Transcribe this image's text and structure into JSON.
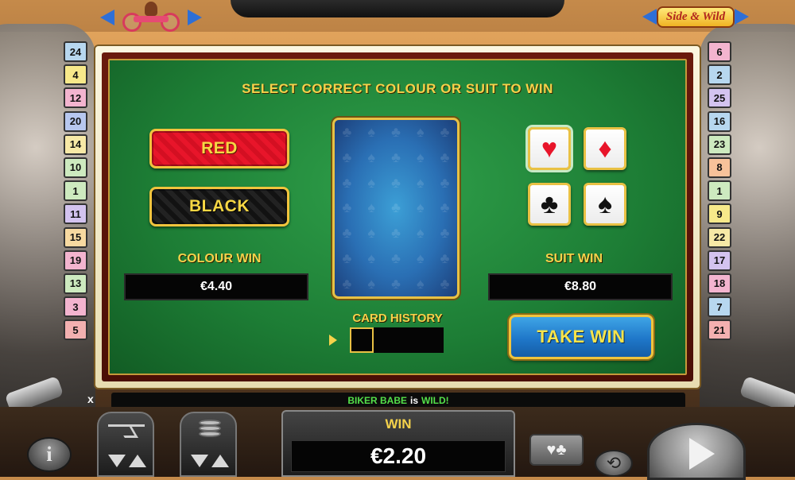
{
  "logos": {
    "game_logo": "Side & Wild"
  },
  "left_numbers": [
    {
      "n": "24",
      "color": "#b7d7ef"
    },
    {
      "n": "4",
      "color": "#f7e98a"
    },
    {
      "n": "12",
      "color": "#f3b4cf"
    },
    {
      "n": "20",
      "color": "#b7c7ef"
    },
    {
      "n": "14",
      "color": "#f7e9a6"
    },
    {
      "n": "10",
      "color": "#cdeabf"
    },
    {
      "n": "1",
      "color": "#cdeabf"
    },
    {
      "n": "11",
      "color": "#d3c3ef"
    },
    {
      "n": "15",
      "color": "#f7d9a0"
    },
    {
      "n": "19",
      "color": "#f3b4cf"
    },
    {
      "n": "13",
      "color": "#cdeabf"
    },
    {
      "n": "3",
      "color": "#f3b4cf"
    },
    {
      "n": "5",
      "color": "#f3b0b0"
    }
  ],
  "right_numbers": [
    {
      "n": "6",
      "color": "#f3b4cf"
    },
    {
      "n": "2",
      "color": "#b7d7ef"
    },
    {
      "n": "25",
      "color": "#d3c3ef"
    },
    {
      "n": "16",
      "color": "#b7d7ef"
    },
    {
      "n": "23",
      "color": "#cdeabf"
    },
    {
      "n": "8",
      "color": "#f7c29a"
    },
    {
      "n": "1",
      "color": "#cdeabf"
    },
    {
      "n": "9",
      "color": "#f7e98a"
    },
    {
      "n": "22",
      "color": "#f7e9a6"
    },
    {
      "n": "17",
      "color": "#d3c3ef"
    },
    {
      "n": "18",
      "color": "#f3b4cf"
    },
    {
      "n": "7",
      "color": "#b7d7ef"
    },
    {
      "n": "21",
      "color": "#f3b0b0"
    }
  ],
  "gamble": {
    "title": "SELECT CORRECT COLOUR OR SUIT TO WIN",
    "red_label": "RED",
    "black_label": "BLACK",
    "colour_win_label": "COLOUR WIN",
    "colour_win_value": "€4.40",
    "suit_win_label": "SUIT WIN",
    "suit_win_value": "€8.80",
    "card_history_label": "CARD HISTORY",
    "take_win_label": "TAKE WIN",
    "suits": [
      {
        "name": "hearts",
        "symbol": "♥"
      },
      {
        "name": "diamonds",
        "symbol": "♦"
      },
      {
        "name": "clubs",
        "symbol": "♣"
      },
      {
        "name": "spades",
        "symbol": "♠"
      }
    ]
  },
  "status": {
    "close_mark": "x",
    "part1": "BIKER BABE",
    "part2": "is",
    "part3": "WILD!"
  },
  "bottom": {
    "info_label": "i",
    "win_title": "WIN",
    "win_value": "€2.20",
    "gamble_icon": "♥♣",
    "autoplay_icon": "⟲"
  },
  "colors": {
    "felt_green": "#1d7d35",
    "gold_text": "#f5d24b",
    "red_button": "#e8152a",
    "take_win_blue": "#1f77c9"
  }
}
